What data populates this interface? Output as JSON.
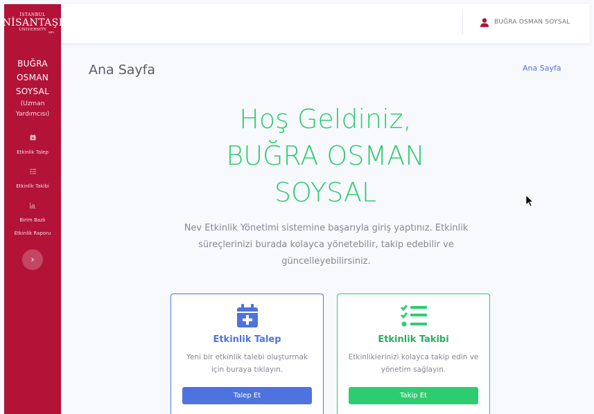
{
  "sidebar": {
    "logo": {
      "line1": "İSTANBUL",
      "line2": "NİSANTAŞI",
      "line3": "UNIVERSITY",
      "line4": "NEV"
    },
    "user_name_1": "BUĞRA",
    "user_name_2": "OSMAN",
    "user_name_3": "SOYSAL",
    "user_role_1": "(Uzman",
    "user_role_2": "Yardımcısı)",
    "nav": [
      {
        "label": "Etkinlik Talep",
        "icon": "calendar-plus-icon"
      },
      {
        "label": "Etkinlik Takibi",
        "icon": "list-check-icon"
      },
      {
        "label": "Birim Bazlı",
        "label2": "Etkinlik Raporu",
        "icon": "chart-icon"
      }
    ],
    "toggle_icon": "›"
  },
  "topbar": {
    "user_name": "BUĞRA OSMAN SOYSAL",
    "user_icon": "user-icon"
  },
  "page": {
    "title": "Ana Sayfa",
    "breadcrumb": "Ana Sayfa",
    "welcome_line1": "Hoş Geldiniz,",
    "welcome_line2": "BUĞRA OSMAN",
    "welcome_line3": "SOYSAL",
    "welcome_text": "Nev Etkinlik Yönetimi sistemine başarıyla giriş yaptınız. Etkinlik süreçlerinizi burada kolayca yönetebilir, takip edebilir ve güncelleyebilirsiniz."
  },
  "cards": [
    {
      "title": "Etkinlik Talep",
      "text": "Yeni bir etkinlik talebi oluşturmak için buraya tıklayın.",
      "button": "Talep Et",
      "icon": "calendar-plus-icon",
      "color": "#4e73df"
    },
    {
      "title": "Etkinlik Takibi",
      "text": "Etkinliklerinizi kolayca takip edin ve yönetim sağlayın.",
      "button": "Takip Et",
      "icon": "list-check-icon",
      "color": "#2ecc71"
    }
  ],
  "colors": {
    "sidebar": "#b21337",
    "primary": "#4e73df",
    "success": "#2ecc71"
  }
}
